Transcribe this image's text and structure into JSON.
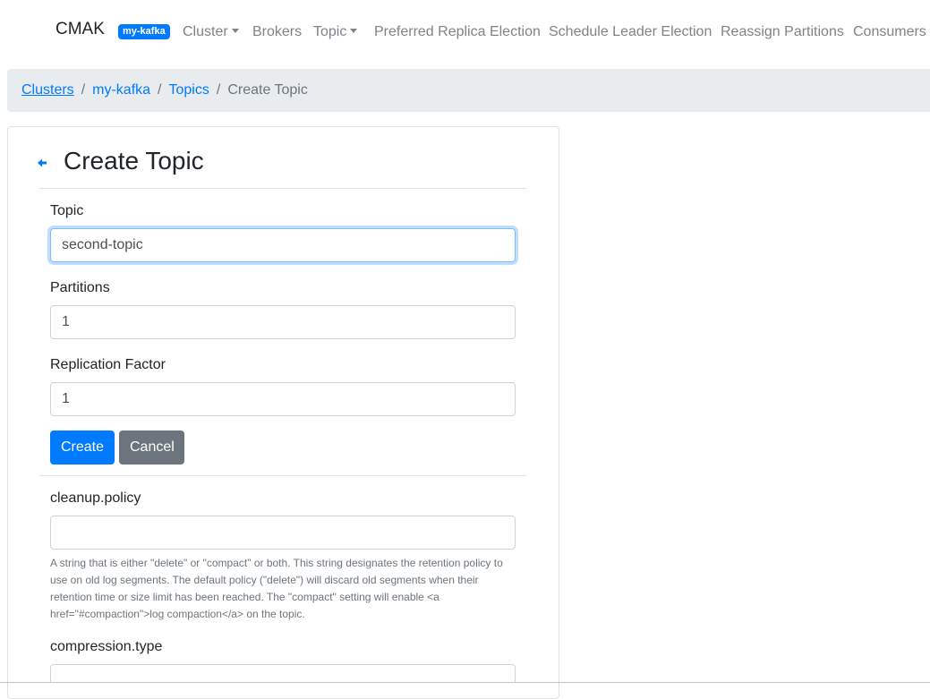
{
  "navbar": {
    "brand": "CMAK",
    "cluster_badge": "my-kafka",
    "items": [
      {
        "label": "Cluster",
        "dropdown": true
      },
      {
        "label": "Brokers",
        "dropdown": false
      },
      {
        "label": "Topic",
        "dropdown": true
      },
      {
        "label": "Preferred Replica Election",
        "dropdown": false
      },
      {
        "label": "Schedule Leader Election",
        "dropdown": false
      },
      {
        "label": "Reassign Partitions",
        "dropdown": false
      },
      {
        "label": "Consumers",
        "dropdown": false
      }
    ]
  },
  "breadcrumb": {
    "items": [
      "Clusters",
      "my-kafka",
      "Topics"
    ],
    "separator": "/",
    "active": "Create Topic"
  },
  "form": {
    "back_icon": "arrow-left-icon",
    "title": "Create Topic",
    "topic": {
      "label": "Topic",
      "value": "second-topic"
    },
    "partitions": {
      "label": "Partitions",
      "value": "1"
    },
    "replication": {
      "label": "Replication Factor",
      "value": "1"
    },
    "create_label": "Create",
    "cancel_label": "Cancel",
    "cleanup": {
      "label": "cleanup.policy",
      "value": "",
      "help": "A string that is either \"delete\" or \"compact\" or both. This string designates the retention policy to use on old log segments. The default policy (\"delete\") will discard old segments when their retention time or size limit has been reached. The \"compact\" setting will enable <a href=\"#compaction\">log compaction</a> on the topic."
    },
    "compression": {
      "label": "compression.type",
      "value": ""
    }
  },
  "colors": {
    "primary": "#007bff",
    "secondary": "#6c757d",
    "breadcrumb_bg": "#e9ecef",
    "nav_text": "#7f8388"
  }
}
